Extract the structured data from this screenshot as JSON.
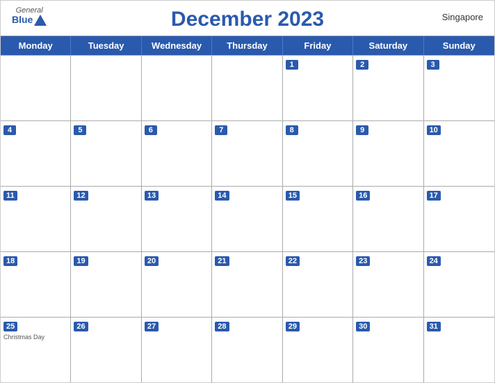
{
  "header": {
    "title": "December 2023",
    "country": "Singapore",
    "logo": {
      "general": "General",
      "blue": "Blue"
    }
  },
  "dayHeaders": [
    "Monday",
    "Tuesday",
    "Wednesday",
    "Thursday",
    "Friday",
    "Saturday",
    "Sunday"
  ],
  "weeks": [
    [
      {
        "number": "",
        "holiday": ""
      },
      {
        "number": "",
        "holiday": ""
      },
      {
        "number": "",
        "holiday": ""
      },
      {
        "number": "",
        "holiday": ""
      },
      {
        "number": "1",
        "holiday": ""
      },
      {
        "number": "2",
        "holiday": ""
      },
      {
        "number": "3",
        "holiday": ""
      }
    ],
    [
      {
        "number": "4",
        "holiday": ""
      },
      {
        "number": "5",
        "holiday": ""
      },
      {
        "number": "6",
        "holiday": ""
      },
      {
        "number": "7",
        "holiday": ""
      },
      {
        "number": "8",
        "holiday": ""
      },
      {
        "number": "9",
        "holiday": ""
      },
      {
        "number": "10",
        "holiday": ""
      }
    ],
    [
      {
        "number": "11",
        "holiday": ""
      },
      {
        "number": "12",
        "holiday": ""
      },
      {
        "number": "13",
        "holiday": ""
      },
      {
        "number": "14",
        "holiday": ""
      },
      {
        "number": "15",
        "holiday": ""
      },
      {
        "number": "16",
        "holiday": ""
      },
      {
        "number": "17",
        "holiday": ""
      }
    ],
    [
      {
        "number": "18",
        "holiday": ""
      },
      {
        "number": "19",
        "holiday": ""
      },
      {
        "number": "20",
        "holiday": ""
      },
      {
        "number": "21",
        "holiday": ""
      },
      {
        "number": "22",
        "holiday": ""
      },
      {
        "number": "23",
        "holiday": ""
      },
      {
        "number": "24",
        "holiday": ""
      }
    ],
    [
      {
        "number": "25",
        "holiday": "Christmas Day"
      },
      {
        "number": "26",
        "holiday": ""
      },
      {
        "number": "27",
        "holiday": ""
      },
      {
        "number": "28",
        "holiday": ""
      },
      {
        "number": "29",
        "holiday": ""
      },
      {
        "number": "30",
        "holiday": ""
      },
      {
        "number": "31",
        "holiday": ""
      }
    ]
  ]
}
